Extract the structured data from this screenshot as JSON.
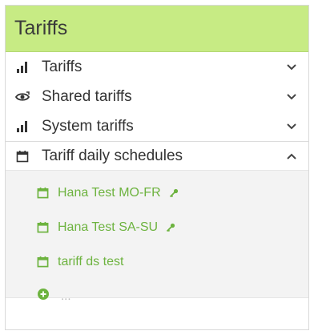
{
  "header": {
    "title": "Tariffs"
  },
  "menu": {
    "items": [
      {
        "label": "Tariffs",
        "icon": "bar-chart-icon",
        "state": "collapsed"
      },
      {
        "label": "Shared tariffs",
        "icon": "shared-eye-icon",
        "state": "collapsed"
      },
      {
        "label": "System tariffs",
        "icon": "bar-chart-icon",
        "state": "collapsed"
      },
      {
        "label": "Tariff daily schedules",
        "icon": "calendar-icon",
        "state": "expanded"
      }
    ]
  },
  "schedules": {
    "items": [
      {
        "label": "Hana Test MO-FR",
        "icon": "calendar-icon",
        "badge": "key-icon"
      },
      {
        "label": "Hana Test SA-SU",
        "icon": "calendar-icon",
        "badge": "key-icon"
      },
      {
        "label": "tariff ds test",
        "icon": "calendar-icon"
      }
    ],
    "add_label": "..."
  },
  "colors": {
    "header_bg": "#c7eb84",
    "accent_green": "#6db33f",
    "submenu_bg": "#f3f3f3"
  }
}
